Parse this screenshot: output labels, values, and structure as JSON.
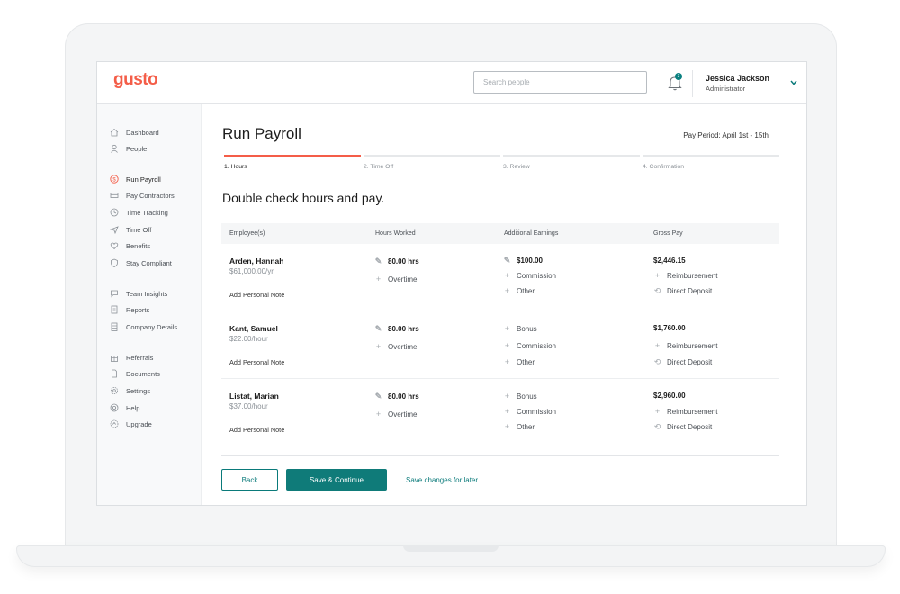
{
  "header": {
    "logo": "gusto",
    "search_placeholder": "Search people",
    "notification_count": "3",
    "user_name": "Jessica Jackson",
    "user_role": "Administrator"
  },
  "sidebar": {
    "items": [
      {
        "label": "Dashboard",
        "icon": "home-icon"
      },
      {
        "label": "People",
        "icon": "person-icon"
      },
      {
        "label": "Run Payroll",
        "icon": "dollar-icon",
        "active": true
      },
      {
        "label": "Pay Contractors",
        "icon": "card-icon"
      },
      {
        "label": "Time Tracking",
        "icon": "clock-icon"
      },
      {
        "label": "Time Off",
        "icon": "plane-icon"
      },
      {
        "label": "Benefits",
        "icon": "heart-icon"
      },
      {
        "label": "Stay Compliant",
        "icon": "shield-icon"
      },
      {
        "label": "Team Insights",
        "icon": "chat-icon"
      },
      {
        "label": "Reports",
        "icon": "report-icon"
      },
      {
        "label": "Company Details",
        "icon": "building-icon"
      },
      {
        "label": "Referrals",
        "icon": "gift-icon"
      },
      {
        "label": "Documents",
        "icon": "document-icon"
      },
      {
        "label": "Settings",
        "icon": "gear-icon"
      },
      {
        "label": "Help",
        "icon": "help-icon"
      },
      {
        "label": "Upgrade",
        "icon": "upgrade-icon"
      }
    ]
  },
  "main": {
    "title": "Run Payroll",
    "pay_period": "Pay Period: April 1st - 15th",
    "steps": [
      "1. Hours",
      "2. Time Off",
      "3. Review",
      "4. Confirmation"
    ],
    "section_title": "Double check hours and pay.",
    "columns": [
      "Employee(s)",
      "Hours Worked",
      "Additional Earnings",
      "Gross Pay"
    ],
    "rows": [
      {
        "name": "Arden, Hannah",
        "rate": "$61,000.00/yr",
        "note": "Add Personal Note",
        "hours": "80.00 hrs",
        "overtime": "Overtime",
        "earnings": [
          "$100.00",
          "Commission",
          "Other"
        ],
        "gross": "$2,446.15",
        "reimbursement": "Reimbursement",
        "deposit": "Direct Deposit"
      },
      {
        "name": "Kant, Samuel",
        "rate": "$22.00/hour",
        "note": "Add Personal Note",
        "hours": "80.00 hrs",
        "overtime": "Overtime",
        "earnings": [
          "Bonus",
          "Commission",
          "Other"
        ],
        "gross": "$1,760.00",
        "reimbursement": "Reimbursement",
        "deposit": "Direct Deposit"
      },
      {
        "name": "Listat, Marian",
        "rate": "$37.00/hour",
        "note": "Add Personal Note",
        "hours": "80.00 hrs",
        "overtime": "Overtime",
        "earnings": [
          "Bonus",
          "Commission",
          "Other"
        ],
        "gross": "$2,960.00",
        "reimbursement": "Reimbursement",
        "deposit": "Direct Deposit"
      }
    ],
    "back_label": "Back",
    "save_label": "Save & Continue",
    "later_label": "Save changes for later"
  },
  "colors": {
    "brand": "#f45d48",
    "accent": "#0f7b79"
  }
}
